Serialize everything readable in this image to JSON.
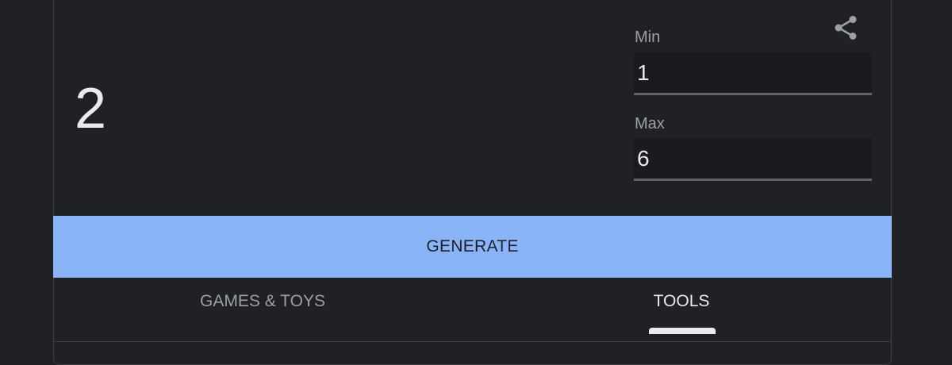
{
  "result": "2",
  "fields": {
    "min": {
      "label": "Min",
      "value": "1"
    },
    "max": {
      "label": "Max",
      "value": "6"
    }
  },
  "generate_label": "GENERATE",
  "tabs": [
    {
      "label": "GAMES & TOYS",
      "active": false
    },
    {
      "label": "TOOLS",
      "active": true
    }
  ],
  "colors": {
    "background": "#202124",
    "accent": "#8ab4f8",
    "text_primary": "#e8eaed",
    "text_secondary": "#9aa0a6"
  },
  "icons": {
    "share": "share-icon"
  }
}
